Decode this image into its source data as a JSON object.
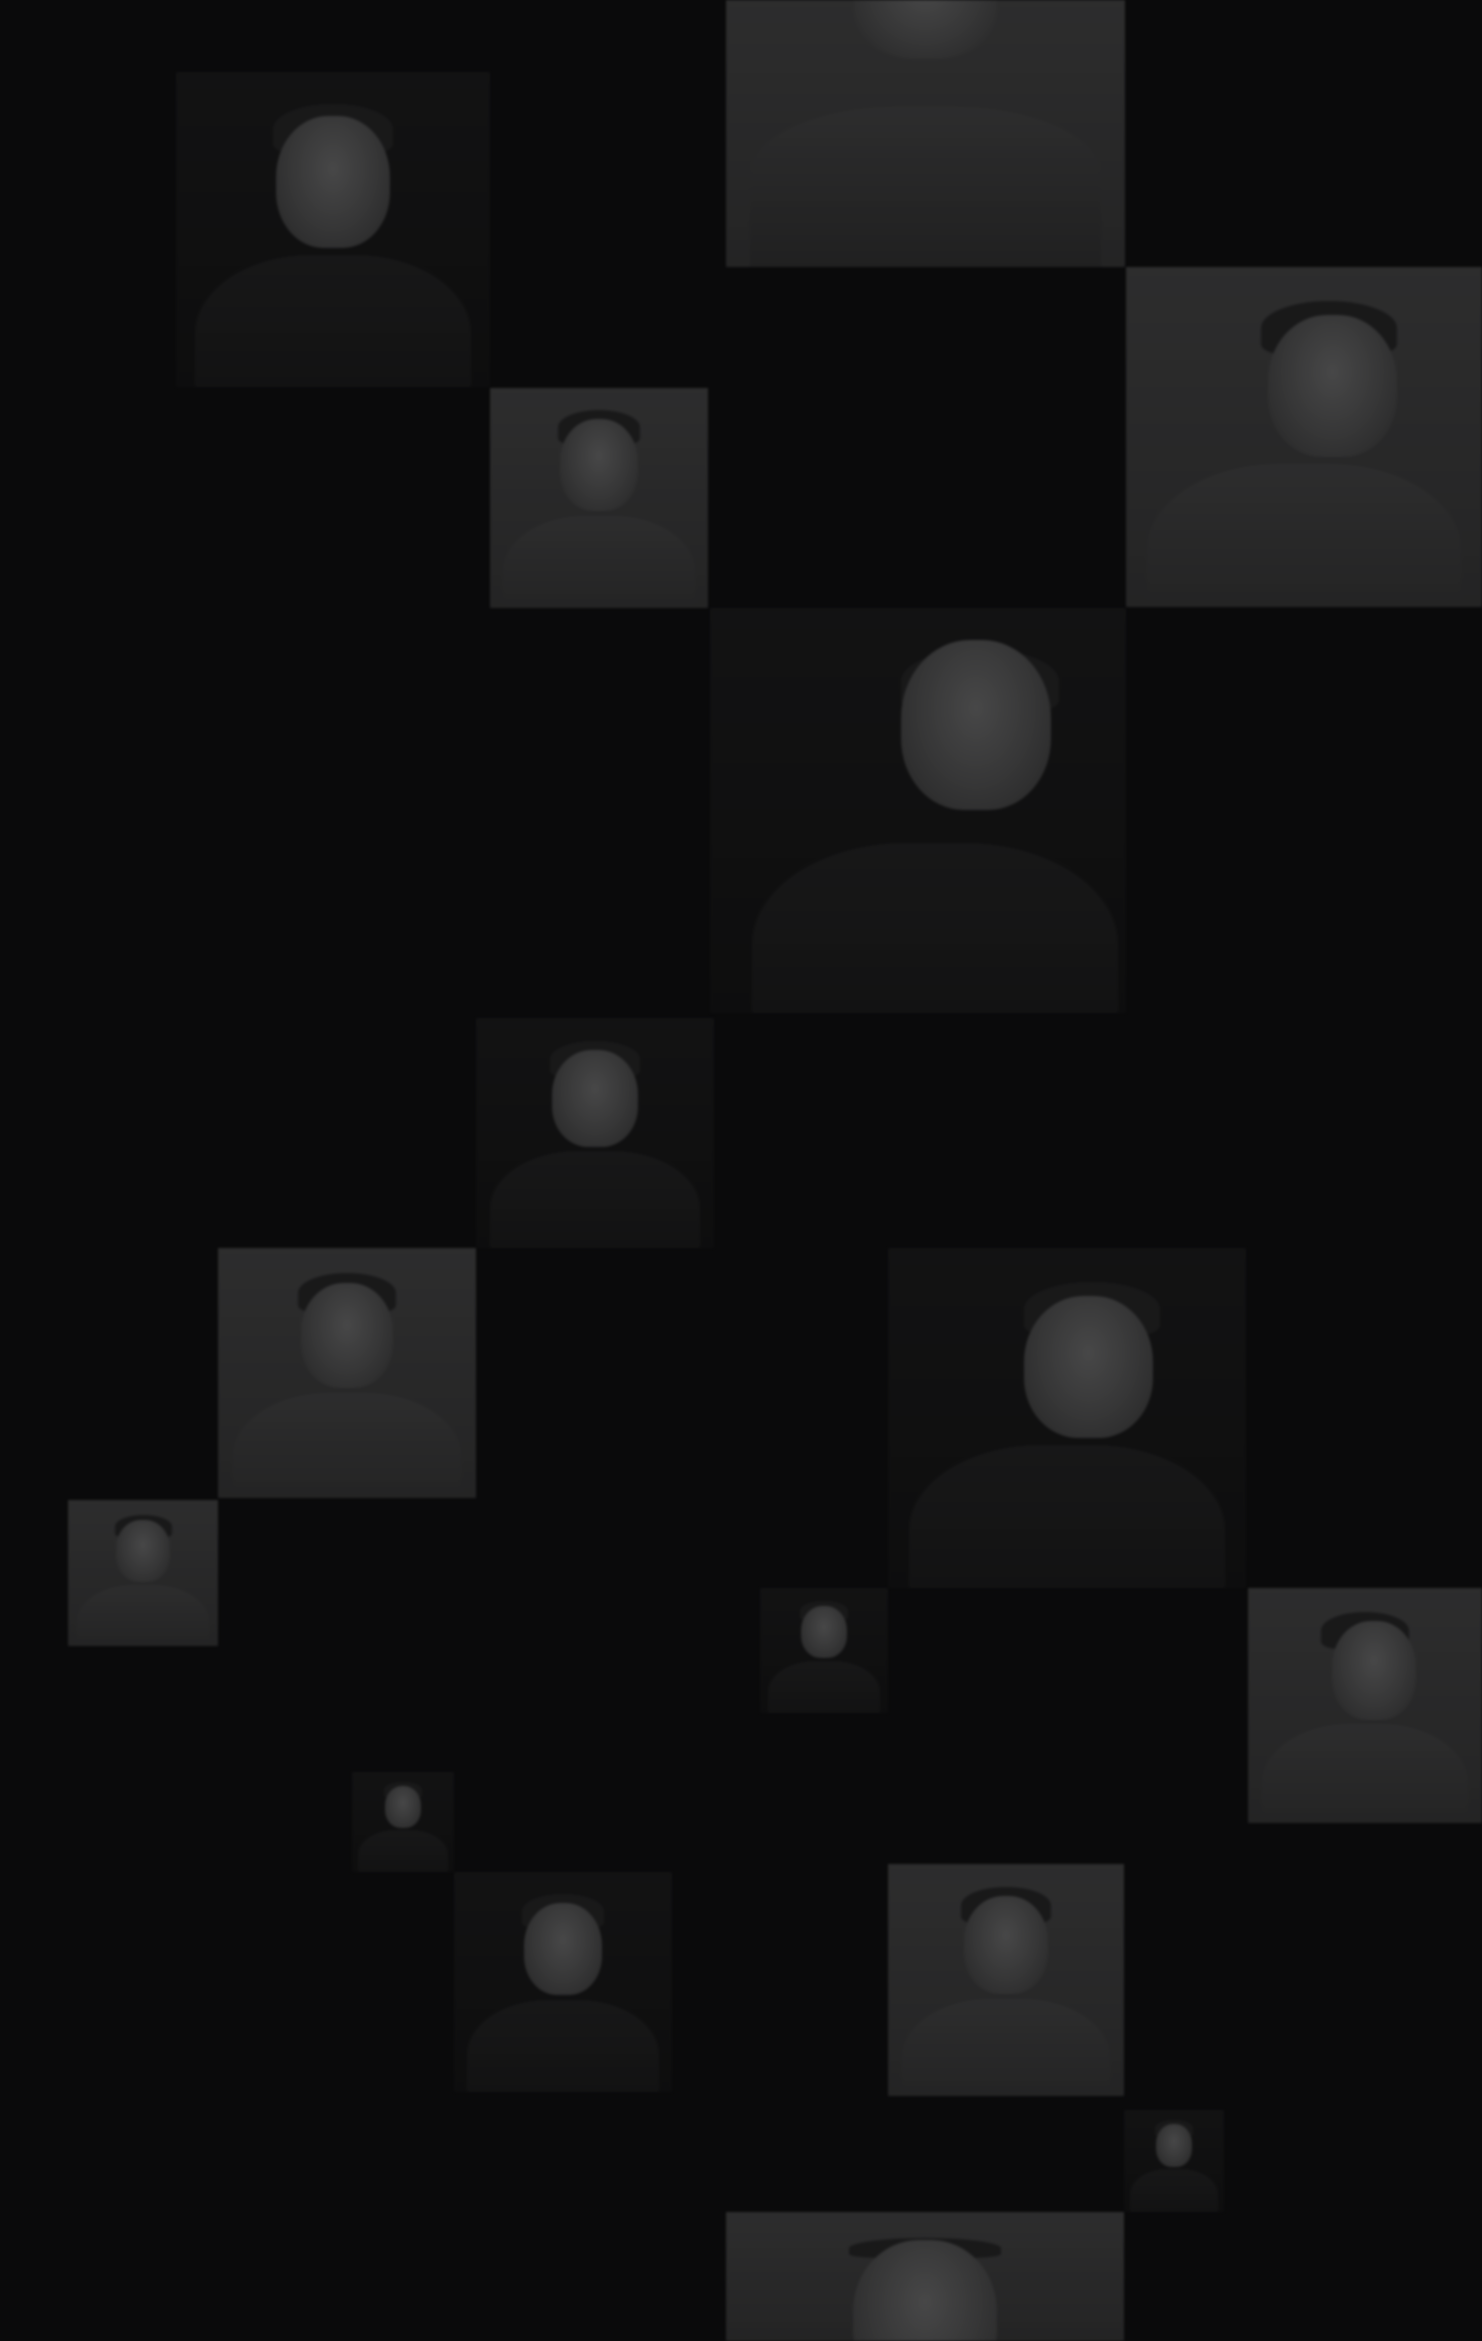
{
  "page": {
    "background": "#0a0a0b",
    "photo_tone": "#3a3a3a"
  },
  "photos": [
    {
      "name": "portrait-photo-1",
      "tone": "dark"
    },
    {
      "name": "portrait-photo-2",
      "tone": "light"
    },
    {
      "name": "portrait-photo-3",
      "tone": "light"
    },
    {
      "name": "portrait-photo-4",
      "tone": "light"
    },
    {
      "name": "portrait-photo-5",
      "tone": "dark"
    },
    {
      "name": "portrait-photo-6",
      "tone": "dark"
    },
    {
      "name": "portrait-photo-7",
      "tone": "light"
    },
    {
      "name": "portrait-photo-8",
      "tone": "dark"
    },
    {
      "name": "portrait-photo-9",
      "tone": "light"
    },
    {
      "name": "portrait-photo-10",
      "tone": "dark"
    },
    {
      "name": "portrait-photo-11",
      "tone": "light"
    },
    {
      "name": "portrait-photo-12",
      "tone": "dark"
    },
    {
      "name": "portrait-photo-13",
      "tone": "dark"
    },
    {
      "name": "portrait-photo-14",
      "tone": "light"
    },
    {
      "name": "portrait-photo-15",
      "tone": "dark"
    },
    {
      "name": "portrait-photo-16",
      "tone": "light"
    }
  ]
}
